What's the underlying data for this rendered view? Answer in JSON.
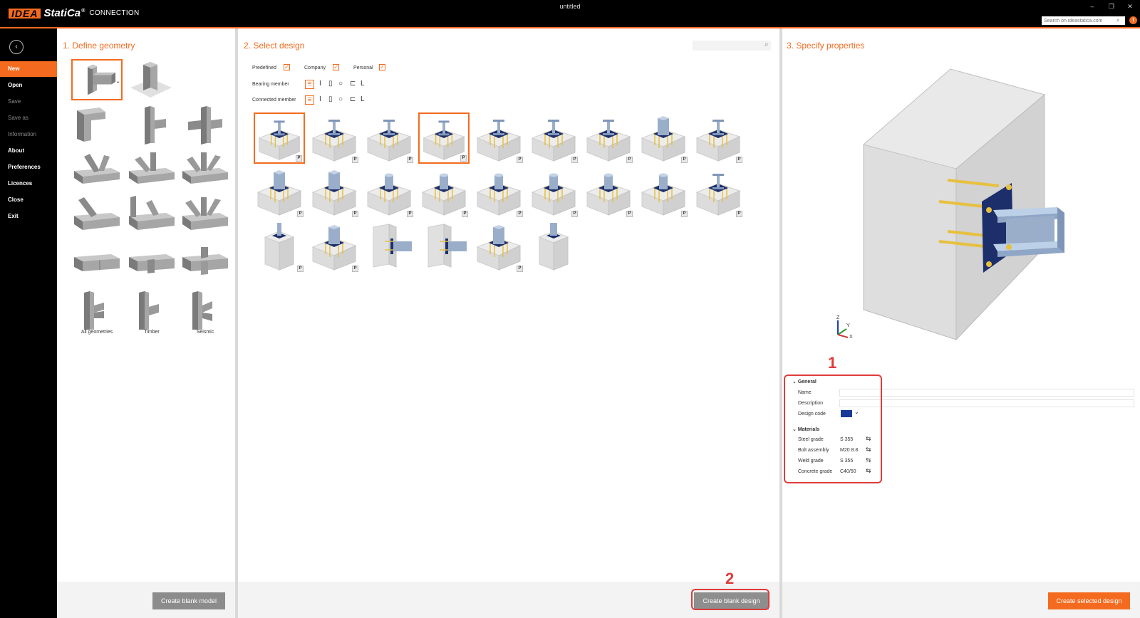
{
  "app": {
    "logo_brand": "IDEA",
    "logo_product_name": "StatiCa",
    "logo_registered": "®",
    "module": "CONNECTION",
    "window_title": "untitled",
    "search_placeholder": "Search on ideastatica.com",
    "window_controls": [
      "–",
      "❐",
      "✕"
    ],
    "notification_glyph": "!"
  },
  "sidebar": {
    "back_glyph": "‹",
    "items": [
      {
        "label": "New",
        "state": "active"
      },
      {
        "label": "Open",
        "state": "enabled"
      },
      {
        "label": "Save",
        "state": "disabled"
      },
      {
        "label": "Save as",
        "state": "disabled"
      },
      {
        "label": "Information",
        "state": "disabled"
      },
      {
        "label": "About",
        "state": "enabled"
      },
      {
        "label": "Preferences",
        "state": "enabled"
      },
      {
        "label": "Licences",
        "state": "enabled"
      },
      {
        "label": "Close",
        "state": "enabled"
      },
      {
        "label": "Exit",
        "state": "enabled"
      }
    ]
  },
  "geometry_panel": {
    "title": "1. Define geometry",
    "labels": {
      "all": "All geometries",
      "timber": "Timber",
      "seismic": "Seismic"
    },
    "create_button": "Create blank model"
  },
  "design_panel": {
    "title": "2. Select design",
    "filters": {
      "predefined": "Predefined",
      "company": "Company",
      "personal": "Personal",
      "checkmark": "✓"
    },
    "bearing_member": "Bearing member",
    "connected_member": "Connected member",
    "member_types": [
      "I",
      "▯",
      "○",
      "⊏",
      "L"
    ],
    "badge": "P",
    "create_button": "Create blank design"
  },
  "properties_panel": {
    "title": "3. Specify properties",
    "axes": {
      "z": "Z",
      "y": "Y",
      "x": "X"
    },
    "general": {
      "heading": "General",
      "name_label": "Name",
      "description_label": "Description",
      "design_code_label": "Design code"
    },
    "materials": {
      "heading": "Materials",
      "rows": [
        {
          "label": "Steel grade",
          "value": "S 355"
        },
        {
          "label": "Bolt assembly",
          "value": "M20 8.8"
        },
        {
          "label": "Weld grade",
          "value": "S 355"
        },
        {
          "label": "Concrete grade",
          "value": "C40/50"
        }
      ]
    },
    "create_button": "Create selected design"
  },
  "annotations": {
    "one": "1",
    "two": "2"
  },
  "colors": {
    "accent": "#f46b1f",
    "annotation": "#e03c3c",
    "steel": "#9aaec9",
    "plate": "#1d2f6a",
    "bolt": "#e7c040",
    "concrete": "#e4e4e4"
  }
}
